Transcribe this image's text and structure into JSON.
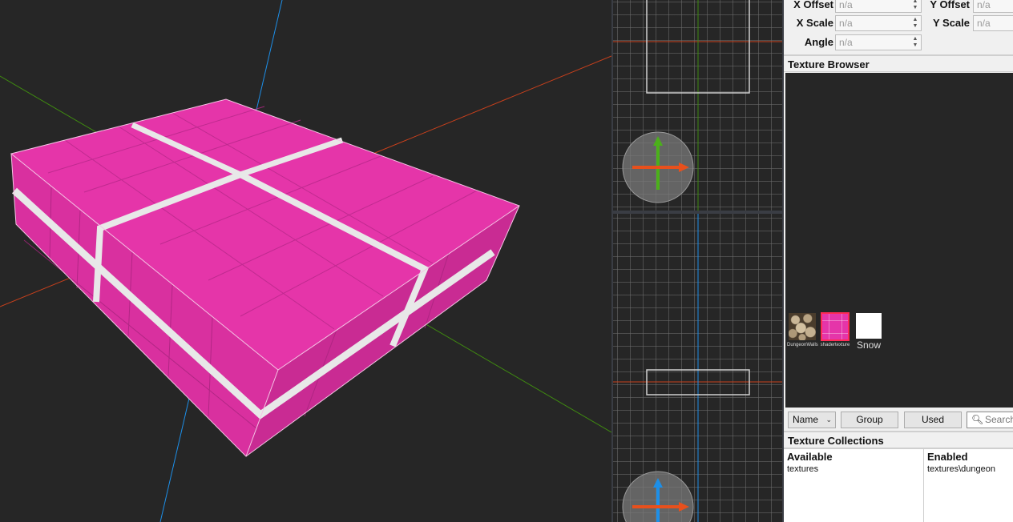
{
  "properties": {
    "x_offset_label": "X Offset",
    "x_offset_value": "n/a",
    "y_offset_label": "Y Offset",
    "y_offset_value": "n/a",
    "x_scale_label": "X Scale",
    "x_scale_value": "n/a",
    "y_scale_label": "Y Scale",
    "y_scale_value": "n/a",
    "angle_label": "Angle",
    "angle_value": "n/a"
  },
  "texture_browser": {
    "title": "Texture Browser",
    "textures": [
      {
        "name": "DungeonWalls",
        "icon": "stone-wall-texture"
      },
      {
        "name": "shadertexture",
        "icon": "pink-grid-texture",
        "selected": true
      },
      {
        "name": "Snow",
        "icon": "white-texture"
      }
    ]
  },
  "toolbar": {
    "sort_select": "Name",
    "group_button": "Group",
    "used_button": "Used",
    "search_placeholder": "Search"
  },
  "texture_collections": {
    "title": "Texture Collections",
    "available_header": "Available",
    "available_items": [
      "textures"
    ],
    "enabled_header": "Enabled",
    "enabled_items": [
      "textures\\dungeon"
    ]
  },
  "colors": {
    "brush_face": "#e535a9",
    "axis_x": "#e0461f",
    "axis_y": "#4b9a12",
    "axis_z": "#1d8fe8",
    "viewport_bg": "#262626",
    "selection_outline": "#ff2a55"
  }
}
